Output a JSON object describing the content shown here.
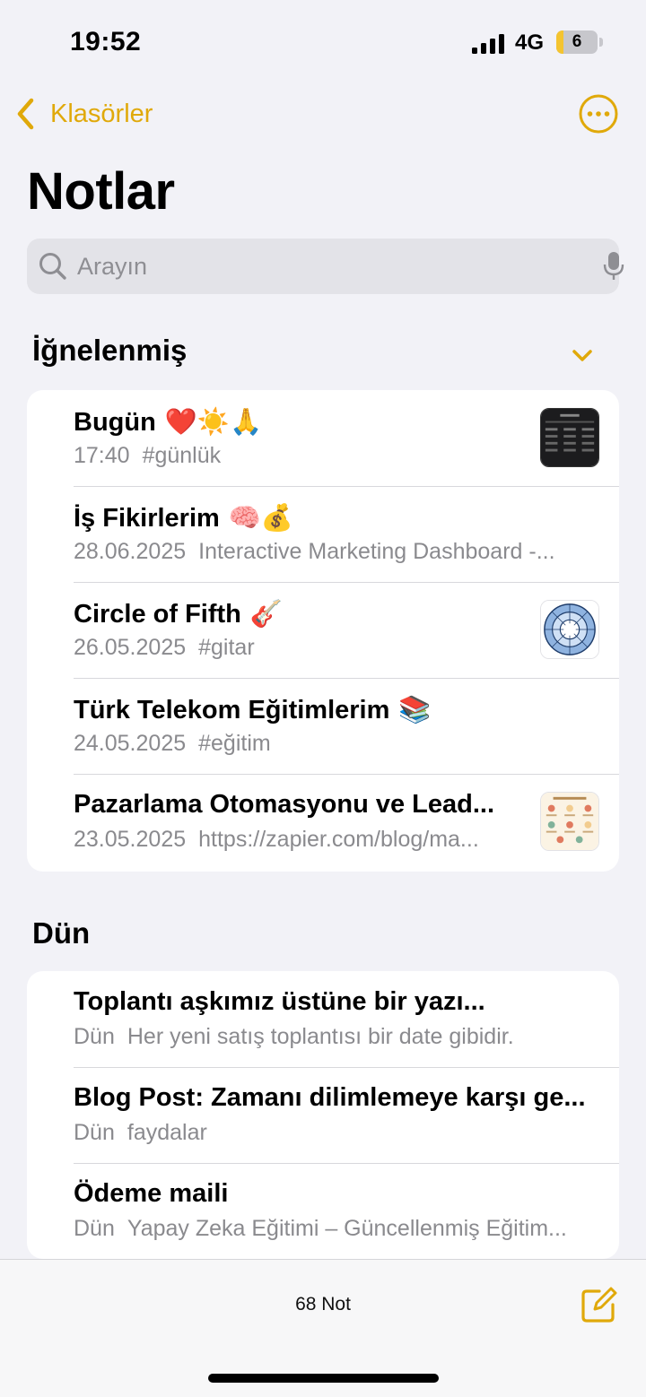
{
  "status_bar": {
    "time": "19:52",
    "network": "4G",
    "battery_level": "6",
    "battery_fraction": 0.06,
    "battery_color": "#f4c430"
  },
  "nav": {
    "back_label": "Klasörler",
    "back_icon": "chevron-left-icon",
    "more_icon": "ellipsis-circle-icon",
    "accent_color": "#e0a90a"
  },
  "page_title": "Notlar",
  "search": {
    "placeholder": "Arayın",
    "value": "",
    "icon": "search-icon",
    "mic_icon": "mic-icon"
  },
  "pinned_section": {
    "header": "İğnelenmiş",
    "collapse_icon": "chevron-down-icon",
    "notes": [
      {
        "title": "Bugün",
        "emoji": "❤️☀️🙏",
        "date": "17:40",
        "snippet": "#günlük",
        "thumbnail": "dark-table-thumbnail"
      },
      {
        "title": "İş Fikirlerim",
        "emoji": "🧠💰",
        "date": "28.06.2025",
        "snippet": "Interactive Marketing Dashboard -..."
      },
      {
        "title": "Circle of Fifth",
        "emoji": "🎸",
        "date": "26.05.2025",
        "snippet": "#gitar",
        "thumbnail": "circle-of-fifths-thumbnail"
      },
      {
        "title": "Türk Telekom Eğitimlerim",
        "emoji": "📚",
        "date": "24.05.2025",
        "snippet": "#eğitim"
      },
      {
        "title": "Pazarlama Otomasyonu ve Lead...",
        "emoji": "",
        "date": "23.05.2025",
        "snippet": "https://zapier.com/blog/ma...",
        "thumbnail": "infographic-thumbnail"
      }
    ]
  },
  "yesterday_section": {
    "header": "Dün",
    "notes": [
      {
        "title": "Toplantı aşkımız üstüne bir yazı...",
        "date": "Dün",
        "snippet": "Her yeni satış toplantısı bir date gibidir."
      },
      {
        "title": "Blog Post: Zamanı dilimlemeye karşı ge...",
        "date": "Dün",
        "snippet": "faydalar"
      },
      {
        "title": "Ödeme maili",
        "date": "Dün",
        "snippet": "Yapay Zeka Eğitimi – Güncellenmiş Eğitim..."
      }
    ]
  },
  "toolbar": {
    "count_label": "68 Not",
    "compose_icon": "compose-icon"
  }
}
